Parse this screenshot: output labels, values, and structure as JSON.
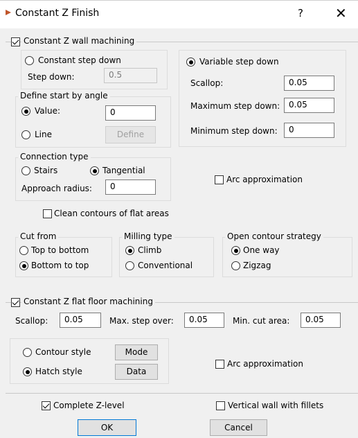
{
  "window": {
    "title": "Constant Z Finish",
    "help": "?",
    "close": "✕"
  },
  "wall": {
    "label": "Constant Z wall machining",
    "checked": true,
    "constant_step_down": {
      "label": "Constant step down",
      "selected": false
    },
    "step_down": {
      "label": "Step down:",
      "value": "0.5"
    },
    "variable_step_down": {
      "label": "Variable step down",
      "selected": true
    },
    "scallop": {
      "label": "Scallop:",
      "value": "0.05"
    },
    "max_step_down": {
      "label": "Maximum step down:",
      "value": "0.05"
    },
    "min_step_down": {
      "label": "Minimum step down:",
      "value": "0"
    },
    "start_angle": {
      "legend": "Define start by angle",
      "value_option": {
        "label": "Value:",
        "selected": true,
        "value": "0"
      },
      "line_option": {
        "label": "Line",
        "selected": false
      },
      "define_button": "Define"
    },
    "connection": {
      "legend": "Connection type",
      "stairs": {
        "label": "Stairs",
        "selected": false
      },
      "tangential": {
        "label": "Tangential",
        "selected": true
      },
      "approach_radius": {
        "label": "Approach radius:",
        "value": "0"
      }
    },
    "arc_approximation": {
      "label": "Arc approximation",
      "checked": false
    },
    "clean_contours": {
      "label": "Clean contours of flat areas",
      "checked": false
    },
    "cut_from": {
      "legend": "Cut from",
      "top_to_bottom": {
        "label": "Top to bottom",
        "selected": false
      },
      "bottom_to_top": {
        "label": "Bottom to top",
        "selected": true
      }
    },
    "milling_type": {
      "legend": "Milling type",
      "climb": {
        "label": "Climb",
        "selected": true
      },
      "conventional": {
        "label": "Conventional",
        "selected": false
      }
    },
    "open_contour": {
      "legend": "Open contour strategy",
      "one_way": {
        "label": "One way",
        "selected": true
      },
      "zigzag": {
        "label": "Zigzag",
        "selected": false
      }
    }
  },
  "floor": {
    "label": "Constant Z flat floor machining",
    "checked": true,
    "scallop": {
      "label": "Scallop:",
      "value": "0.05"
    },
    "max_step_over": {
      "label": "Max. step over:",
      "value": "0.05"
    },
    "min_cut_area": {
      "label": "Min. cut area:",
      "value": "0.05"
    },
    "contour_style": {
      "label": "Contour style",
      "selected": false,
      "button": "Mode"
    },
    "hatch_style": {
      "label": "Hatch style",
      "selected": true,
      "button": "Data"
    },
    "arc_approximation": {
      "label": "Arc approximation",
      "checked": false
    }
  },
  "bottom": {
    "complete_z_level": {
      "label": "Complete Z-level",
      "checked": true
    },
    "vertical_wall_fillets": {
      "label": "Vertical wall with fillets",
      "checked": false
    },
    "ok": "OK",
    "cancel": "Cancel"
  },
  "colors": {
    "focus_border": "#0078d7",
    "background": "#f0f0f0"
  }
}
